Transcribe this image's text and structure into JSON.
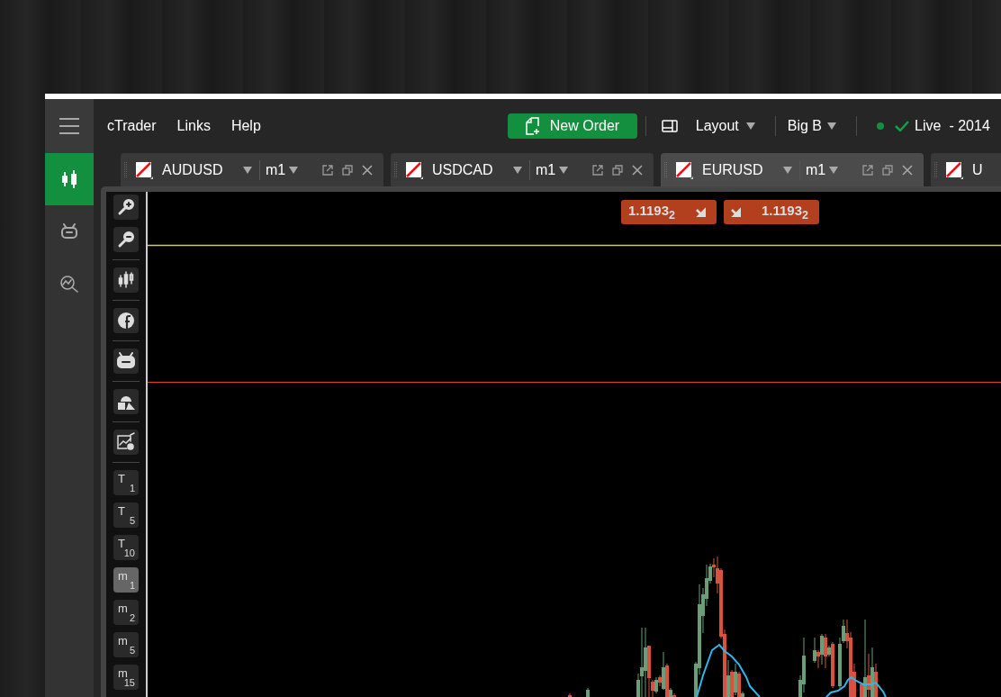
{
  "menu": [
    {
      "label": "cTrader"
    },
    {
      "label": "Links"
    },
    {
      "label": "Help"
    }
  ],
  "new_order": {
    "label": "New Order"
  },
  "layout": {
    "label": "Layout"
  },
  "account": {
    "label": "Big B"
  },
  "connection": {
    "label": "Live",
    "suffix": "- 2014",
    "connected": true
  },
  "sidebar": {
    "items": [
      {
        "kind": "chart",
        "selected": true
      },
      {
        "kind": "robot",
        "selected": false
      },
      {
        "kind": "analysis",
        "selected": false
      }
    ]
  },
  "tabs": [
    {
      "symbol": "AUDUSD",
      "timeframe": "m1",
      "selected": false
    },
    {
      "symbol": "USDCAD",
      "timeframe": "m1",
      "selected": false
    },
    {
      "symbol": "EURUSD",
      "timeframe": "m1",
      "selected": true
    },
    {
      "symbol": "U",
      "selected": false
    }
  ],
  "tool_groups": [
    {
      "tools": [
        {
          "kind": "zoom-in"
        },
        {
          "kind": "zoom-out"
        }
      ]
    },
    {
      "tools": [
        {
          "kind": "candles"
        }
      ]
    },
    {
      "tools": [
        {
          "kind": "facebook"
        }
      ]
    },
    {
      "tools": [
        {
          "kind": "robot"
        }
      ]
    },
    {
      "tools": [
        {
          "kind": "shapes"
        }
      ]
    },
    {
      "tools": [
        {
          "kind": "chart-settings"
        }
      ]
    }
  ],
  "timeframes": [
    {
      "letter": "T",
      "number": "1",
      "selected": false
    },
    {
      "letter": "T",
      "number": "5",
      "selected": false
    },
    {
      "letter": "T",
      "number": "10",
      "selected": false
    },
    {
      "letter": "m",
      "number": "1",
      "selected": true
    },
    {
      "letter": "m",
      "number": "2",
      "selected": false
    },
    {
      "letter": "m",
      "number": "5",
      "selected": false
    },
    {
      "letter": "m",
      "number": "15",
      "selected": false
    }
  ],
  "price_tags": [
    {
      "kind": "bid",
      "price": "1.1193$_{2}$"
    },
    {
      "kind": "ask",
      "price": "1.1193$_{2}$"
    }
  ]
}
